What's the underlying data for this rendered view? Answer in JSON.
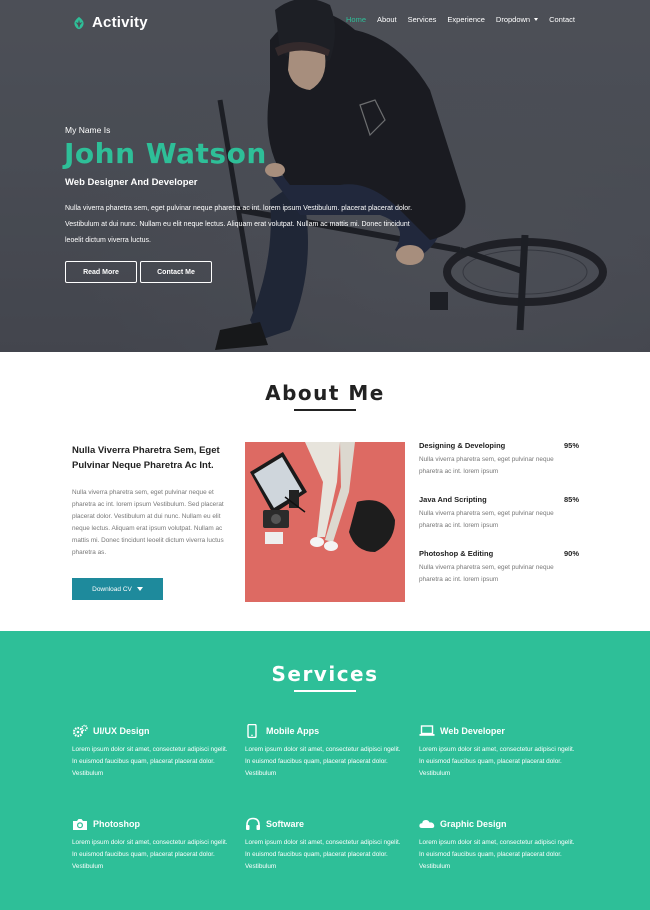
{
  "nav": {
    "logo_text": "Activity",
    "items": [
      {
        "label": "Home",
        "active": true
      },
      {
        "label": "About",
        "active": false
      },
      {
        "label": "Services",
        "active": false
      },
      {
        "label": "Experience",
        "active": false
      },
      {
        "label": "Dropdown",
        "active": false
      },
      {
        "label": "Contact",
        "active": false
      }
    ]
  },
  "hero": {
    "intro": "My Name Is",
    "name": "John Watson",
    "role": "Web Designer And Developer",
    "description": "Nulla viverra pharetra sem, eget pulvinar neque pharetra ac int. lorem ipsum Vestibulum. placerat placerat dolor. Vestibulum at dui nunc. Nullam eu elit neque lectus. Aliquam erat volutpat. Nullam ac mattis mi. Donec tincidunt leoelit dictum viverra luctus.",
    "read_more": "Read More",
    "contact_me": "Contact Me"
  },
  "about": {
    "title": "About Me",
    "heading": "Nulla Viverra Pharetra Sem, Eget Pulvinar Neque Pharetra Ac Int.",
    "text": "Nulla viverra pharetra sem, eget pulvinar neque et pharetra ac int. lorem ipsum Vestibulum. Sed placerat placerat dolor. Vestibulum at dui nunc. Nullam eu elit neque lectus. Aliquam erat ipsum volutpat. Nullam ac mattis mi. Donec tincidunt leoelit dictum viverra luctus pharetra as.",
    "download_label": "Download CV",
    "skills": [
      {
        "name": "Designing & Developing",
        "percent": "95%",
        "desc": "Nulla viverra pharetra sem, eget pulvinar neque pharetra ac int. lorem ipsum"
      },
      {
        "name": "Java And Scripting",
        "percent": "85%",
        "desc": "Nulla viverra pharetra sem, eget pulvinar neque pharetra ac int. lorem ipsum"
      },
      {
        "name": "Photoshop & Editing",
        "percent": "90%",
        "desc": "Nulla viverra pharetra sem, eget pulvinar neque pharetra ac int. lorem ipsum"
      }
    ]
  },
  "services": {
    "title": "Services",
    "items": [
      {
        "title": "UI/UX Design",
        "icon": "gears-icon",
        "text": "Lorem ipsum dolor sit amet, consectetur adipisci ngelit. In euismod faucibus quam, placerat placerat dolor. Vestibulum"
      },
      {
        "title": "Mobile Apps",
        "icon": "mobile-icon",
        "text": "Lorem ipsum dolor sit amet, consectetur adipisci ngelit. In euismod faucibus quam, placerat placerat dolor. Vestibulum"
      },
      {
        "title": "Web Developer",
        "icon": "laptop-icon",
        "text": "Lorem ipsum dolor sit amet, consectetur adipisci ngelit. In euismod faucibus quam, placerat placerat dolor. Vestibulum"
      },
      {
        "title": "Photoshop",
        "icon": "camera-icon",
        "text": "Lorem ipsum dolor sit amet, consectetur adipisci ngelit. In euismod faucibus quam, placerat placerat dolor. Vestibulum"
      },
      {
        "title": "Software",
        "icon": "headphones-icon",
        "text": "Lorem ipsum dolor sit amet, consectetur adipisci ngelit. In euismod faucibus quam, placerat placerat dolor. Vestibulum"
      },
      {
        "title": "Graphic Design",
        "icon": "cloud-icon",
        "text": "Lorem ipsum dolor sit amet, consectetur adipisci ngelit. In euismod faucibus quam, placerat placerat dolor. Vestibulum"
      }
    ]
  },
  "colors": {
    "accent": "#2ebf98",
    "button_blue": "#1e8a9c",
    "photo_bg": "#dd6a63"
  }
}
